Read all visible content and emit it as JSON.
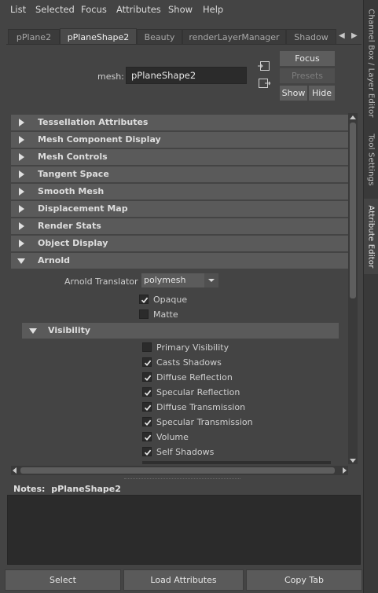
{
  "menu": [
    "List",
    "Selected",
    "Focus",
    "Attributes",
    "Show",
    "Help"
  ],
  "side_tabs": [
    "Channel Box / Layer Editor",
    "Tool Settings",
    "Attribute Editor"
  ],
  "node_tabs": [
    "pPlane2",
    "pPlaneShape2",
    "Beauty",
    "renderLayerManager",
    "Shadow"
  ],
  "active_node_tab": "pPlaneShape2",
  "mesh": {
    "label": "mesh:",
    "value": "pPlaneShape2"
  },
  "buttons": {
    "focus": "Focus",
    "presets": "Presets",
    "show": "Show",
    "hide": "Hide"
  },
  "sections": [
    "Tessellation Attributes",
    "Mesh Component Display",
    "Mesh Controls",
    "Tangent Space",
    "Smooth Mesh",
    "Displacement Map",
    "Render Stats",
    "Object Display",
    "Arnold"
  ],
  "arnold": {
    "translator_label": "Arnold Translator",
    "translator_value": "polymesh",
    "opaque": {
      "label": "Opaque",
      "checked": true
    },
    "matte": {
      "label": "Matte",
      "checked": false
    }
  },
  "visibility": {
    "title": "Visibility",
    "items": [
      {
        "label": "Primary Visibility",
        "checked": false
      },
      {
        "label": "Casts Shadows",
        "checked": true
      },
      {
        "label": "Diffuse Reflection",
        "checked": true
      },
      {
        "label": "Specular Reflection",
        "checked": true
      },
      {
        "label": "Diffuse Transmission",
        "checked": true
      },
      {
        "label": "Specular Transmission",
        "checked": true
      },
      {
        "label": "Volume",
        "checked": true
      },
      {
        "label": "Self Shadows",
        "checked": true
      }
    ]
  },
  "notes": {
    "label": "Notes:",
    "node": "pPlaneShape2"
  },
  "bottom": {
    "select": "Select",
    "load": "Load Attributes",
    "copy": "Copy Tab"
  }
}
